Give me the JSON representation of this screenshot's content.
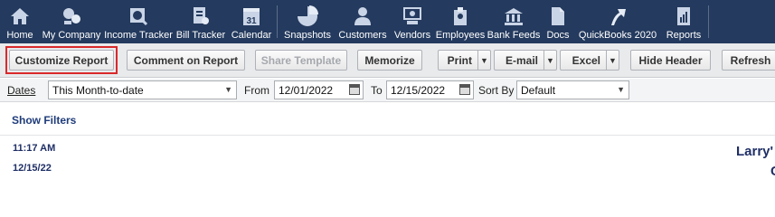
{
  "topnav": {
    "items": [
      {
        "label": "Home",
        "icon": "home-icon"
      },
      {
        "label": "My Company",
        "icon": "my-company-icon"
      },
      {
        "label": "Income Tracker",
        "icon": "income-tracker-icon"
      },
      {
        "label": "Bill Tracker",
        "icon": "bill-tracker-icon"
      },
      {
        "label": "Calendar",
        "icon": "calendar-icon"
      },
      {
        "label": "Snapshots",
        "icon": "snapshots-icon"
      },
      {
        "label": "Customers",
        "icon": "customers-icon"
      },
      {
        "label": "Vendors",
        "icon": "vendors-icon"
      },
      {
        "label": "Employees",
        "icon": "employees-icon"
      },
      {
        "label": "Bank Feeds",
        "icon": "bank-feeds-icon"
      },
      {
        "label": "Docs",
        "icon": "docs-icon"
      },
      {
        "label": "QuickBooks 2020",
        "icon": "quickbooks-icon"
      },
      {
        "label": "Reports",
        "icon": "reports-icon"
      }
    ],
    "calendar_day": "31",
    "bg_color": "#243a5e"
  },
  "toolbar": {
    "customize": "Customize Report",
    "comment": "Comment on Report",
    "share": "Share Template",
    "memorize": "Memorize",
    "print": "Print",
    "email": "E-mail",
    "excel": "Excel",
    "hide_header": "Hide Header",
    "refresh": "Refresh",
    "highlight_color": "#d9292b"
  },
  "filters": {
    "dates_label": "Dates",
    "dates_value": "This Month-to-date",
    "from_label": "From",
    "from_value": "12/01/2022",
    "to_label": "To",
    "to_value": "12/15/2022",
    "sortby_label": "Sort By",
    "sortby_value": "Default"
  },
  "show_filters": "Show Filters",
  "report": {
    "time": "11:17 AM",
    "date": "12/15/22",
    "company": "Larry'",
    "subtitle": "C"
  }
}
